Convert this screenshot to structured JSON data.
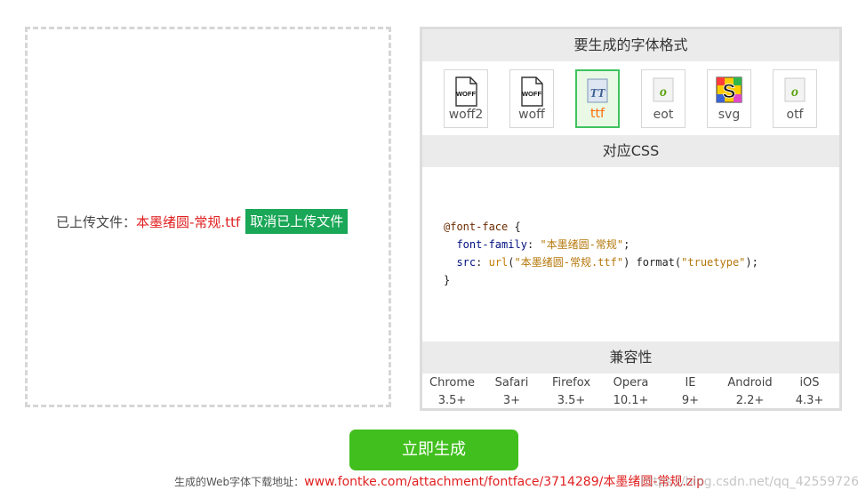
{
  "upload": {
    "label": "已上传文件：",
    "filename": "本墨绪圆-常规.ttf",
    "cancel_label": "取消已上传文件"
  },
  "panel": {
    "format_title": "要生成的字体格式",
    "formats": [
      {
        "label": "woff2",
        "icon": "woff-file-icon",
        "icon_text": "WOFF",
        "selected": false
      },
      {
        "label": "woff",
        "icon": "woff-file-icon",
        "icon_text": "WOFF",
        "selected": false
      },
      {
        "label": "ttf",
        "icon": "truetype-icon",
        "icon_text": "TT",
        "selected": true
      },
      {
        "label": "eot",
        "icon": "eot-file-icon",
        "icon_text": "o",
        "selected": false
      },
      {
        "label": "svg",
        "icon": "svg-file-icon",
        "icon_text": "S",
        "selected": false
      },
      {
        "label": "otf",
        "icon": "otf-file-icon",
        "icon_text": "o",
        "selected": false
      }
    ],
    "css_title": "对应CSS",
    "css": {
      "at_rule": "@font-face",
      "open": " {",
      "family_prop": "font-family",
      "family_value": "\"本墨绪圆-常规\"",
      "src_prop": "src",
      "url_fn": "url",
      "url_value": "\"本墨绪圆-常规.ttf\"",
      "format_fn": "format",
      "format_value": "\"truetype\"",
      "close": "}"
    },
    "compat_title": "兼容性",
    "browsers": [
      {
        "name": "Chrome",
        "version": "3.5+"
      },
      {
        "name": "Safari",
        "version": "3+"
      },
      {
        "name": "Firefox",
        "version": "3.5+"
      },
      {
        "name": "Opera",
        "version": "10.1+"
      },
      {
        "name": "IE",
        "version": "9+"
      },
      {
        "name": "Android",
        "version": "2.2+"
      },
      {
        "name": "iOS",
        "version": "4.3+"
      }
    ]
  },
  "generate": {
    "label": "立即生成",
    "download_label": "生成的Web字体下载地址：",
    "download_url": "www.fontke.com/attachment/fontface/3714289/本墨绪圆-常规.zip"
  },
  "watermark": "https://blog.csdn.net/qq_42559726",
  "colors": {
    "accent_green": "#41bf1e",
    "cancel_green": "#1aa757",
    "link_red": "#e02020",
    "selected_label": "#ff6a00"
  }
}
